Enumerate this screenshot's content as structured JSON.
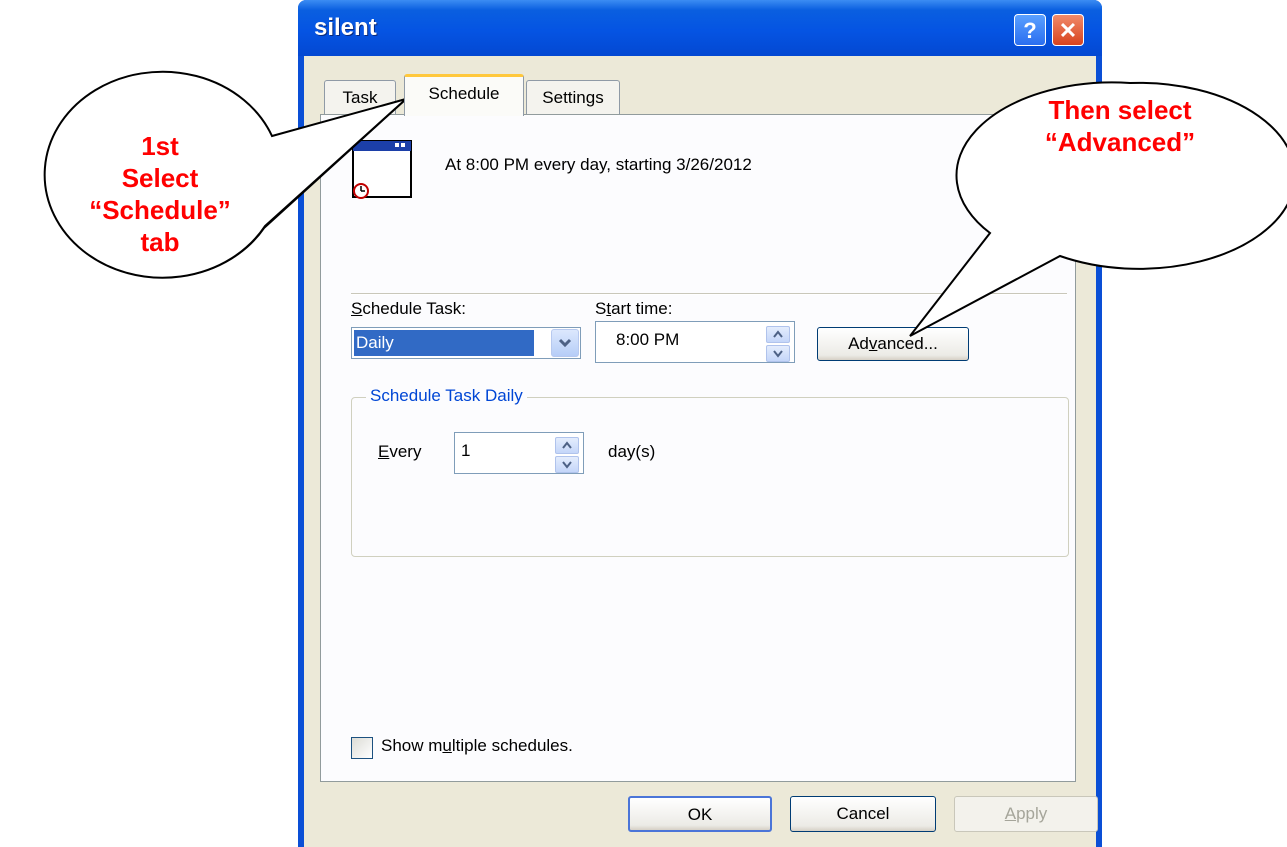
{
  "window": {
    "title": "silent"
  },
  "tabs": [
    "Task",
    "Schedule",
    "Settings"
  ],
  "summary": "At 8:00 PM every day, starting 3/26/2012",
  "schedule_task": {
    "label_pre": "",
    "label_u": "S",
    "label_post": "chedule Task:",
    "value": "Daily"
  },
  "start_time": {
    "label_pre": "S",
    "label_u": "t",
    "label_post": "art time:",
    "value": "8:00 PM"
  },
  "advanced_button": {
    "pre": "Ad",
    "u": "v",
    "post": "anced..."
  },
  "group": {
    "title": "Schedule Task Daily",
    "every_u": "E",
    "every_rest": "very",
    "every_value": "1",
    "unit": "day(s)"
  },
  "show_multiple": {
    "pre": "Show m",
    "u": "u",
    "post": "ltiple schedules."
  },
  "buttons": {
    "ok": "OK",
    "cancel": "Cancel",
    "apply_u": "A",
    "apply_rest": "pply"
  },
  "callouts": {
    "left": [
      "1st",
      "Select",
      "“Schedule”",
      "tab"
    ],
    "right": [
      "Then select",
      "“Advanced”"
    ],
    "color": "#ff0000"
  },
  "colors": {
    "title_bar": "#0554e3",
    "selection": "#316ac5",
    "dialog_bg": "#ece9d8"
  },
  "icons": [
    "help-icon",
    "close-icon",
    "scheduled-task-icon",
    "dropdown-arrow-icon",
    "spinner-icon"
  ]
}
